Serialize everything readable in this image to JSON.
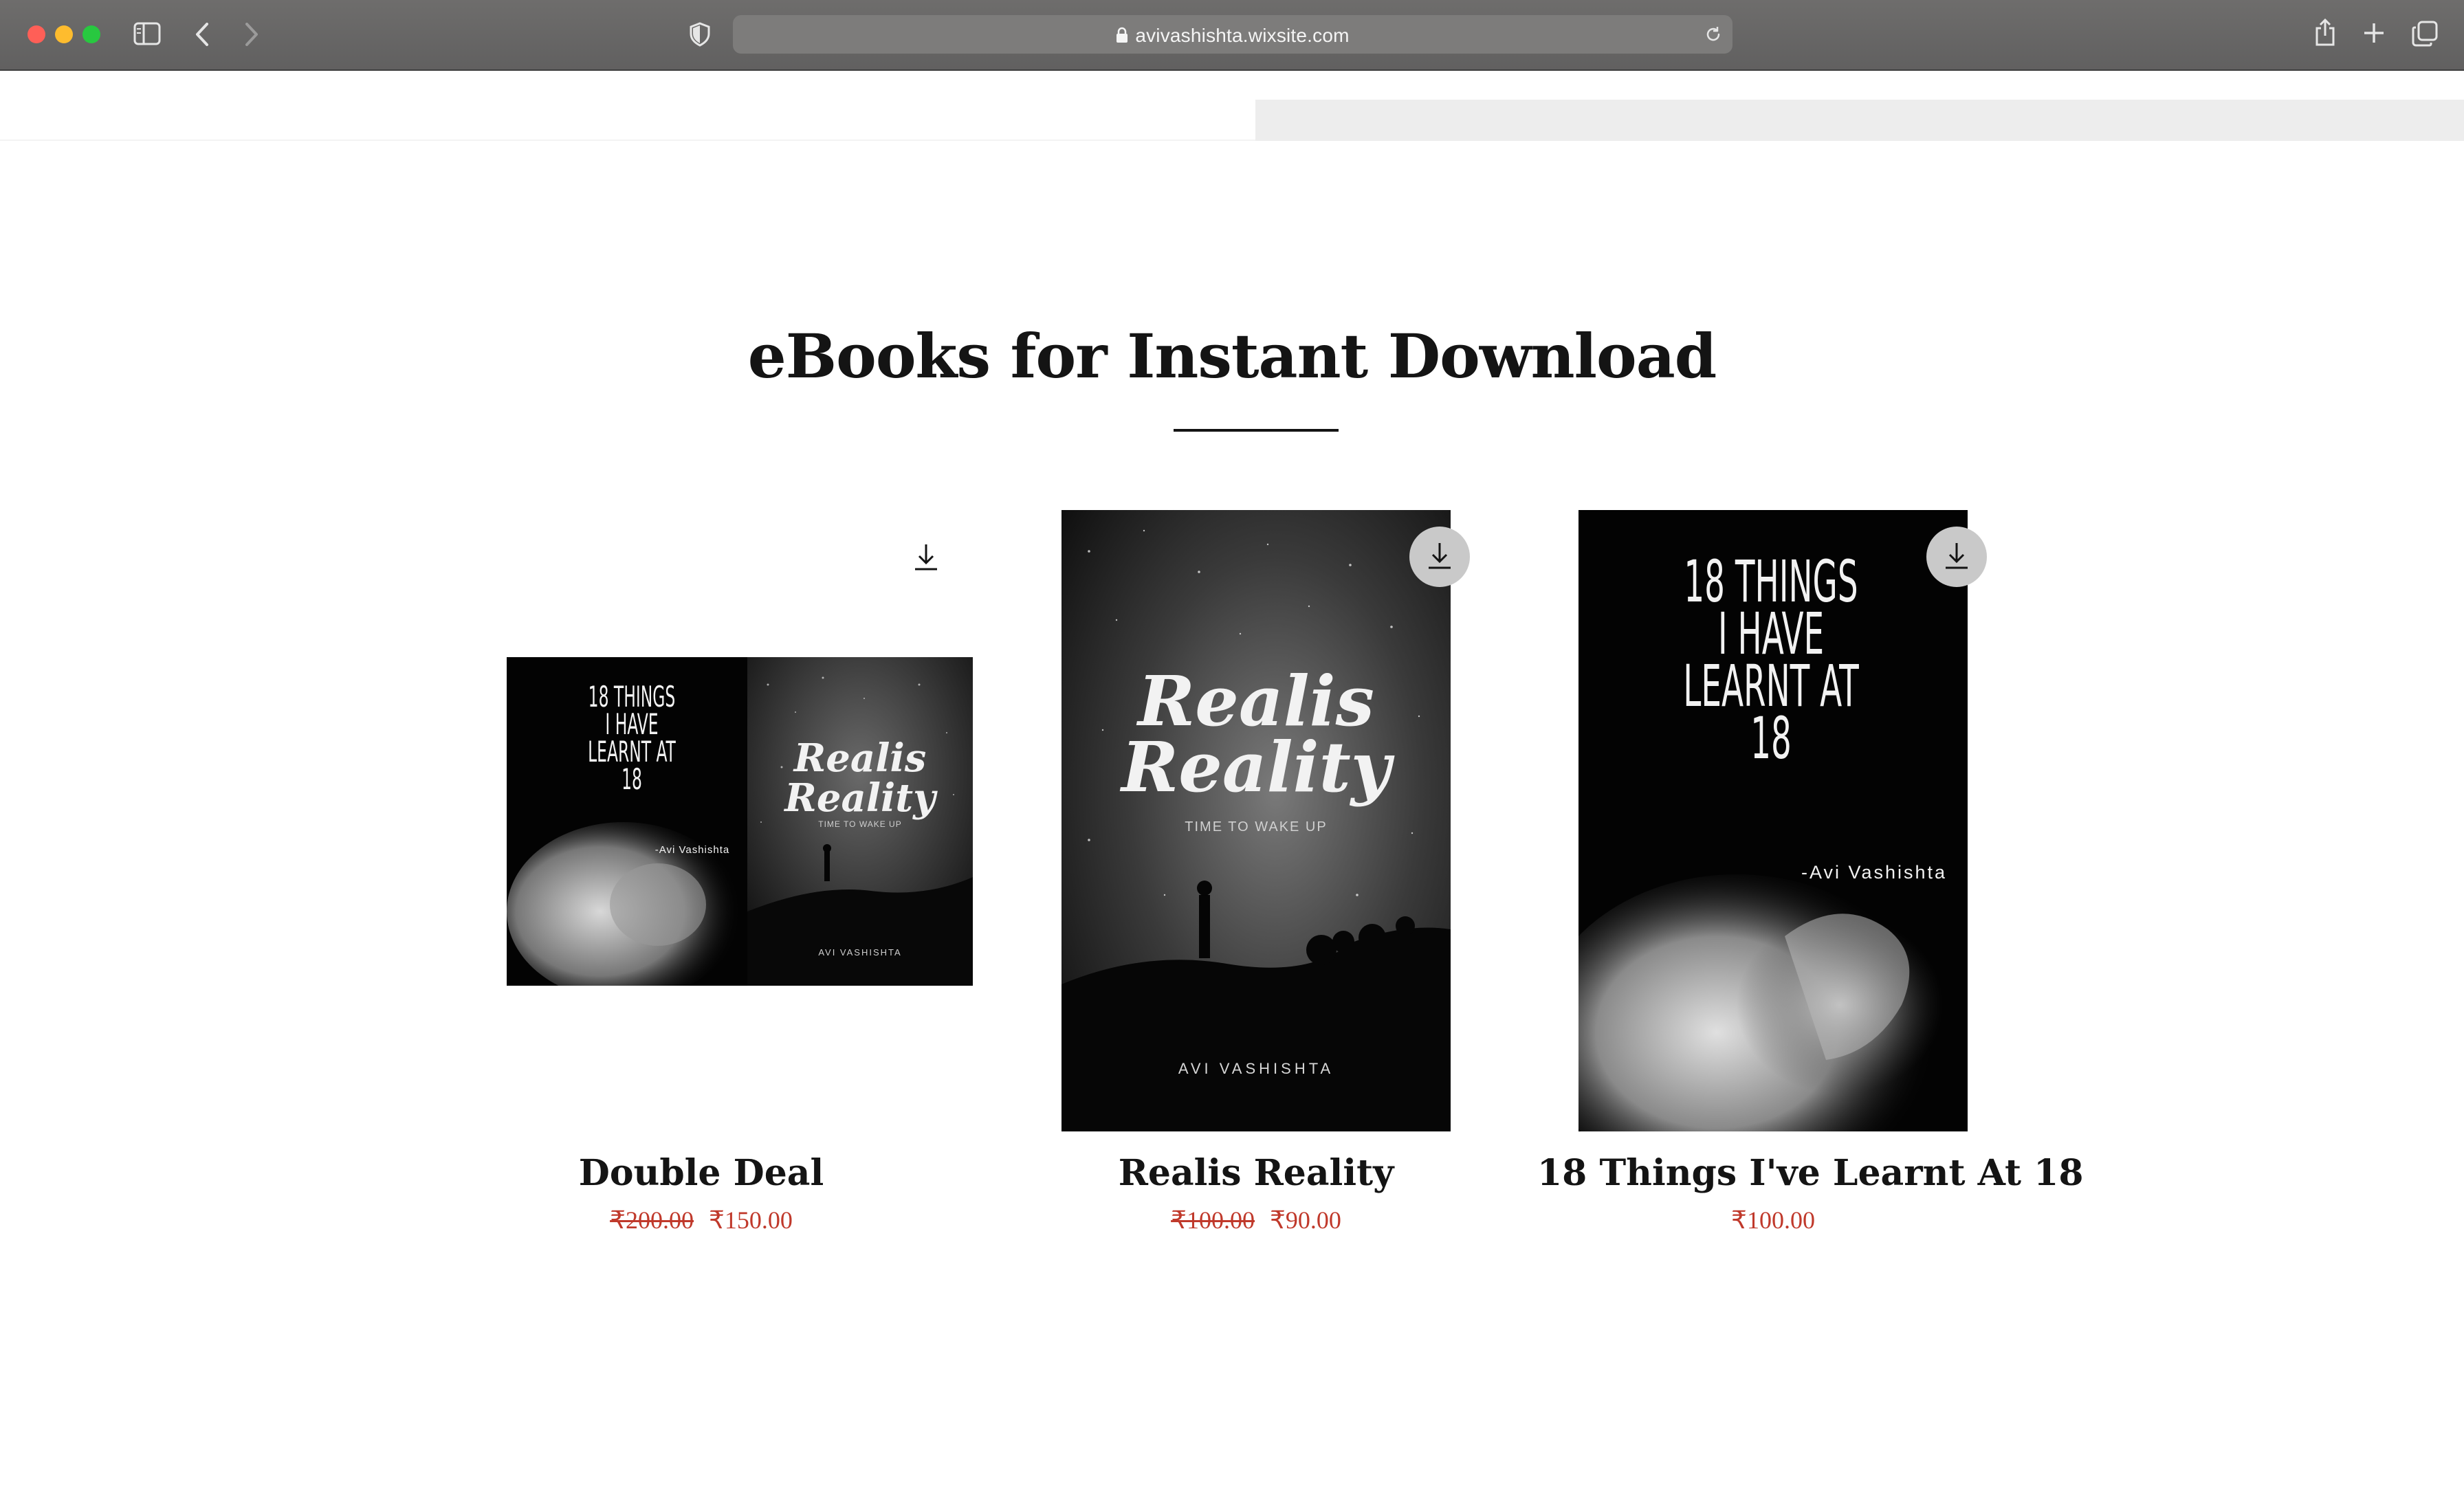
{
  "browser": {
    "url": "avivashishta.wixsite.com",
    "icons": [
      "close-dot",
      "minimize-dot",
      "zoom-dot",
      "sidebar-icon",
      "back-icon",
      "forward-icon",
      "shield-icon",
      "lock-icon",
      "reload-icon",
      "share-icon",
      "new-tab-icon",
      "tabs-overview-icon"
    ],
    "colors": {
      "close": "#ff5f57",
      "minimize": "#febc2e",
      "zoom": "#28c840"
    }
  },
  "section": {
    "title": "eBooks for Instant Download"
  },
  "products": [
    {
      "name": "Double Deal",
      "old_price": "₹200.00",
      "price": "₹150.00",
      "cover_left": {
        "title_lines": [
          "18 THINGS",
          "I HAVE",
          "LEARNT AT",
          "18"
        ],
        "author": "-Avi Vashishta"
      },
      "cover_right": {
        "title_lines": [
          "Realis",
          "Reality"
        ],
        "subtitle": "TIME TO WAKE UP",
        "author": "AVI VASHISHTA"
      }
    },
    {
      "name": "Realis Reality",
      "old_price": "₹100.00",
      "price": "₹90.00",
      "cover": {
        "title_lines": [
          "Realis",
          "Reality"
        ],
        "subtitle": "TIME TO WAKE UP",
        "author": "AVI VASHISHTA"
      }
    },
    {
      "name": "18 Things I've Learnt At 18",
      "price": "₹100.00",
      "cover": {
        "title_lines": [
          "18 THINGS",
          "I HAVE",
          "LEARNT AT",
          "18"
        ],
        "author": "-Avi Vashishta"
      }
    }
  ],
  "theme": {
    "price_color": "#c0392b",
    "text_color": "#141414",
    "header_gray": "#ededed"
  }
}
